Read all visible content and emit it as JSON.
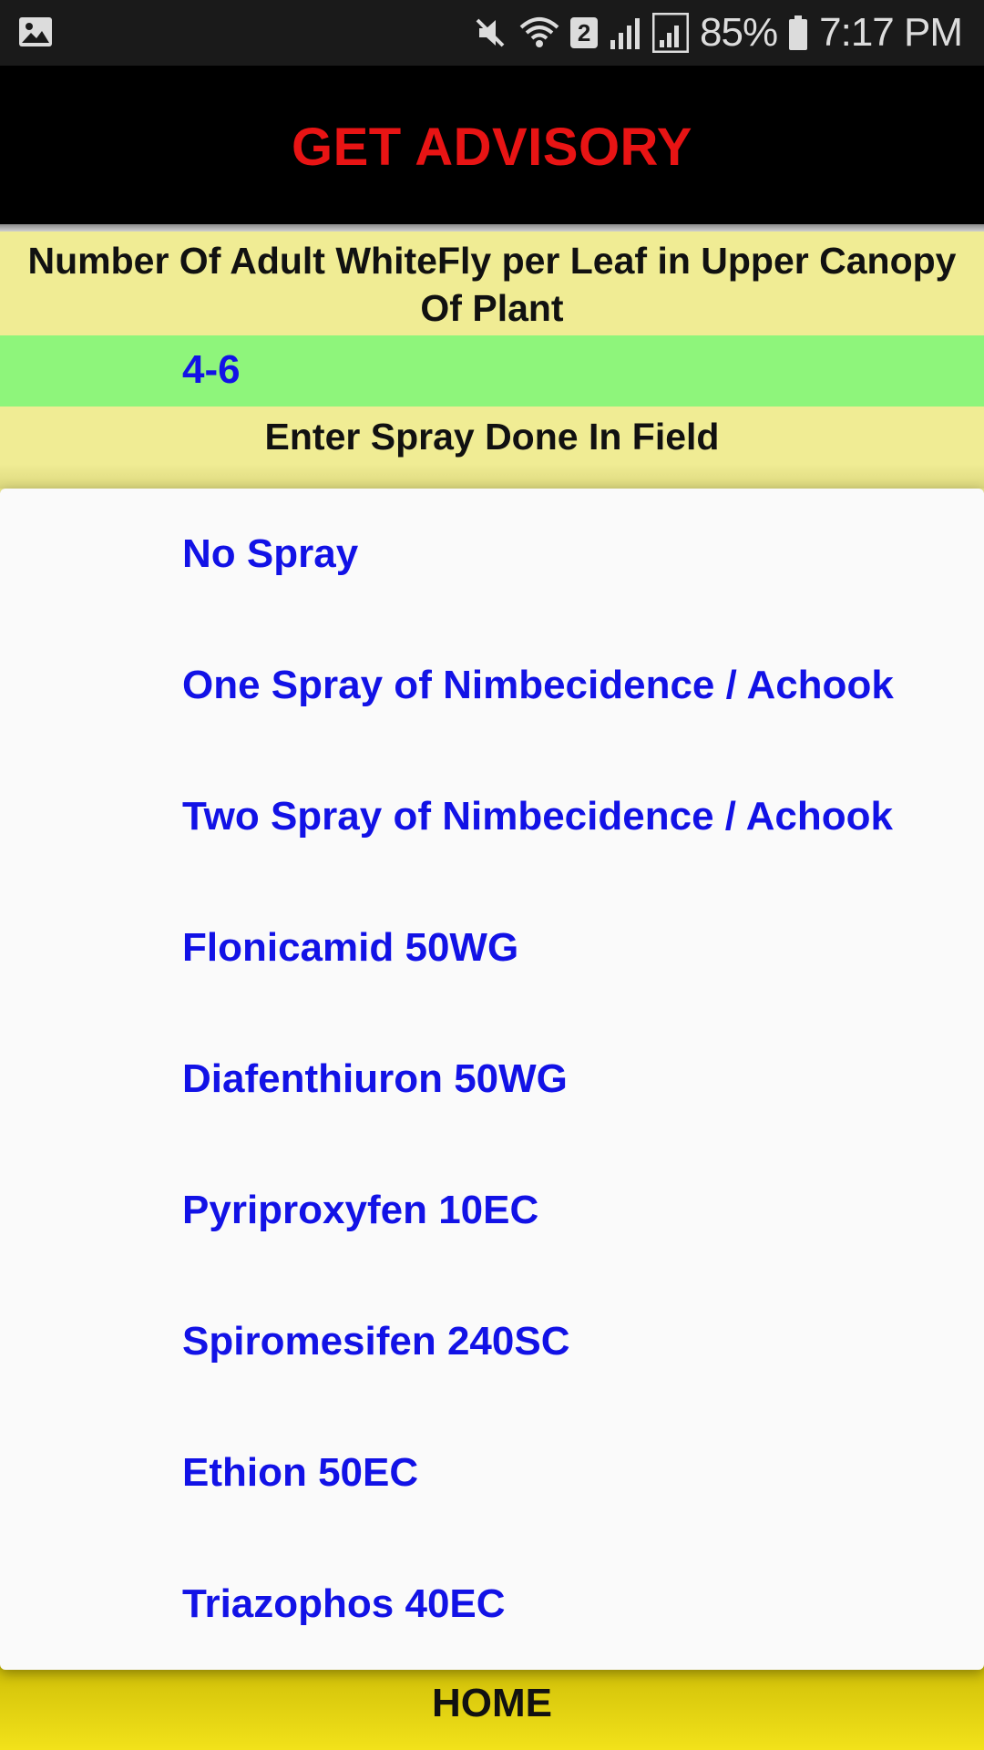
{
  "status_bar": {
    "battery_percent": "85%",
    "time": "7:17 PM",
    "sim_badge": "2",
    "icons": [
      "gallery-icon",
      "mute-icon",
      "wifi-icon",
      "signal-r-icon",
      "signal-icon",
      "battery-icon"
    ]
  },
  "header": {
    "title": "GET ADVISORY",
    "title_color": "#e81414"
  },
  "question": {
    "text": "Number Of Adult WhiteFly per Leaf in Upper Canopy Of Plant",
    "selected_value": "4-6"
  },
  "spray": {
    "label": "Enter Spray Done In Field",
    "options": [
      "No Spray",
      "One Spray of Nimbecidence / Achook",
      "Two Spray of Nimbecidence / Achook",
      "Flonicamid 50WG",
      "Diafenthiuron 50WG",
      "Pyriproxyfen 10EC",
      "Spiromesifen 240SC",
      "Ethion 50EC",
      "Triazophos 40EC"
    ]
  },
  "footer": {
    "home_label": "HOME"
  },
  "colors": {
    "option_text": "#1212e6",
    "answer_bg": "#8ef57b",
    "panel_bg": "#f0ec94",
    "home_bar": "#e6d512"
  }
}
